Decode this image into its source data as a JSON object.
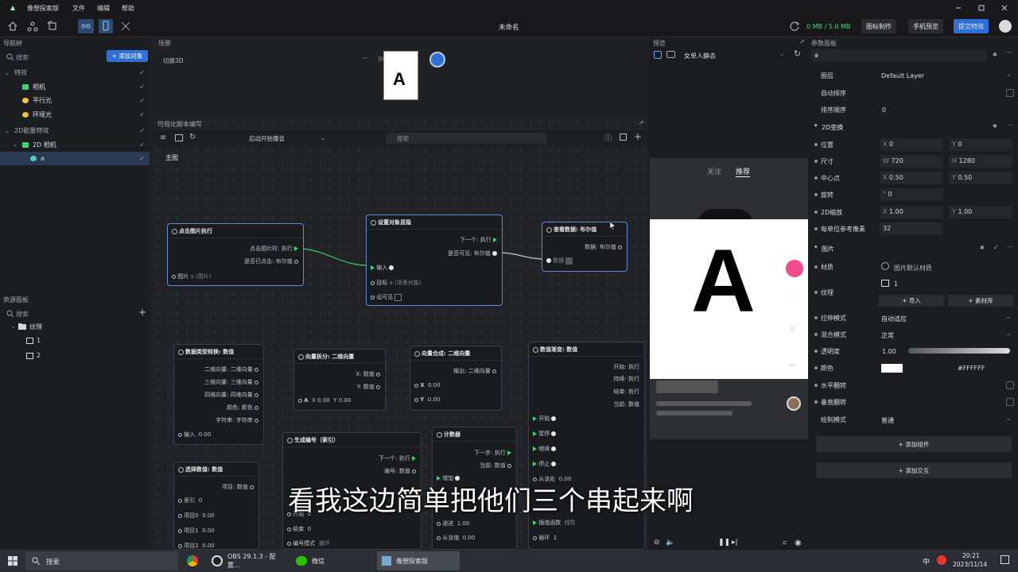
{
  "menubar": {
    "app_name": "像塑探索版",
    "items": [
      "文件",
      "编辑",
      "帮助"
    ]
  },
  "toolbar": {
    "doc_title": "未命名",
    "memory": "0 MB / 5.0 MB",
    "btn_icon": "图标制作",
    "btn_phone": "手机预览",
    "btn_submit": "提交特效"
  },
  "nav": {
    "title": "导航树",
    "search_placeholder": "搜索",
    "add_btn": "+ 添加对象",
    "items": [
      {
        "label": "特效",
        "level": 0
      },
      {
        "label": "相机",
        "level": 1
      },
      {
        "label": "平行光",
        "level": 1
      },
      {
        "label": "环境光",
        "level": 1
      },
      {
        "label": "2D能量特效",
        "level": 0
      },
      {
        "label": "2D 相机",
        "level": 1
      },
      {
        "label": "a",
        "level": 2
      }
    ]
  },
  "assets": {
    "title": "资源面板",
    "search_placeholder": "搜索",
    "folder": "纹理",
    "items": [
      "1",
      "2"
    ]
  },
  "scene": {
    "title": "场景",
    "mode": "切换3D",
    "zoom": "90%",
    "glyph": "A"
  },
  "script": {
    "title": "可视化脚本编写",
    "dropdown": "启动开始播音",
    "search_placeholder": "搜索",
    "tab": "主图"
  },
  "nodes": {
    "n1": {
      "title": "点击图片执行",
      "r1": "点击图片时: 执行",
      "r2": "是否已点击: 布尔值",
      "r3": "图片",
      "r3v": "a (图片)"
    },
    "n2": {
      "title": "设置对象显隐",
      "r1": "下一个: 执行",
      "r2": "是否可见: 布尔值",
      "r3": "输入",
      "r4": "目标",
      "r4v": "a (场景对象)",
      "r5": "设可见"
    },
    "n3": {
      "title": "查看数据: 布尔值",
      "r1": "数据: 布尔值",
      "r2": "数据"
    },
    "n4": {
      "title": "数据类型转换: 数值",
      "rows": [
        "二维向量: 二维向量",
        "三维向量: 三维向量",
        "四维向量: 四维向量",
        "颜色: 颜色",
        "字符串: 字符串"
      ],
      "input": "输入",
      "inputv": "0.00"
    },
    "n5": {
      "title": "向量拆分: 二维向量",
      "r1": "X: 数值",
      "r2": "Y: 数值",
      "in": "A",
      "x": "0.00",
      "y": "0.00"
    },
    "n6": {
      "title": "向量合成: 二维向量",
      "r1": "输出: 二维向量",
      "x": "0.00",
      "y": "0.00"
    },
    "n7": {
      "title": "数值渐变: 数值",
      "outs": [
        "开始: 执行",
        "持续: 执行",
        "结束: 执行",
        "当前: 数值"
      ],
      "ins": [
        "开始",
        "暂停",
        "继续",
        "停止"
      ],
      "from": "从该处",
      "fromv": "0.00",
      "interp": "插值函数",
      "interpv": "线性",
      "loop": "循环",
      "loopv": "1"
    },
    "n8": {
      "title": "选择数值: 数值",
      "r1": "项目: 数值",
      "rows": [
        [
          "索引",
          "0"
        ],
        [
          "项目0",
          "0.00"
        ],
        [
          "项目1",
          "0.00"
        ],
        [
          "项目2",
          "0.00"
        ]
      ]
    },
    "n9": {
      "title": "生成编号（索引）",
      "r1": "下一个: 执行",
      "r2": "编号: 数值",
      "r3": "开始",
      "r3v": "0",
      "r4": "结束",
      "r4v": "0",
      "r5": "编号模式",
      "r5v": "循环"
    },
    "n10": {
      "title": "计数器",
      "r1": "下一步: 执行",
      "r2": "当前: 数值",
      "r3": "增加",
      "r4": "递进",
      "r4v": "1.00",
      "r5": "从该值",
      "r5v": "0.00"
    }
  },
  "preview": {
    "title": "预览",
    "device": "女单人静态",
    "tab_follow": "关注",
    "tab_recommend": "推荐",
    "glyph": "A"
  },
  "props": {
    "title": "参数面板",
    "object": "a",
    "layer_label": "图层",
    "layer_value": "Default Layer",
    "auto_sort": "自动排序",
    "sort_order": "排序顺序",
    "sort_value": "0",
    "t2d": "2D变换",
    "pos": "位置",
    "pos_x": "0",
    "pos_y": "0",
    "size": "尺寸",
    "size_w": "720",
    "size_h": "1280",
    "anchor": "中心点",
    "anchor_x": "0.50",
    "anchor_y": "0.50",
    "rotate": "旋转",
    "rotate_v": "0",
    "scale": "2D缩放",
    "scale_x": "1.00",
    "scale_y": "1.00",
    "ppu": "每单位参考像素",
    "ppu_v": "32",
    "image": "图片",
    "material": "材质",
    "material_v": "图片默认材质",
    "texture": "纹理",
    "texture_v": "1",
    "import_btn": "+ 导入",
    "lib_btn": "+ 素材库",
    "stretch": "拉伸模式",
    "stretch_v": "自动适应",
    "blend": "混合模式",
    "blend_v": "正常",
    "opacity": "透明度",
    "opacity_v": "1.00",
    "opacity_level": 1.0,
    "color": "颜色",
    "color_hex": "#FFFFFF",
    "flip_h": "水平翻转",
    "flip_v": "垂直翻转",
    "draw_mode": "绘制模式",
    "draw_mode_v": "普通",
    "add_component": "+ 添加组件",
    "add_interaction": "+ 添加交互"
  },
  "subtitle": "看我这边简单把他们三个串起来啊",
  "taskbar": {
    "search": "搜索",
    "obs": "OBS 29.1.3 - 配置...",
    "wechat": "微信",
    "app": "像塑探索版",
    "ime": "中",
    "time": "20:21",
    "date": "2023/11/14"
  }
}
